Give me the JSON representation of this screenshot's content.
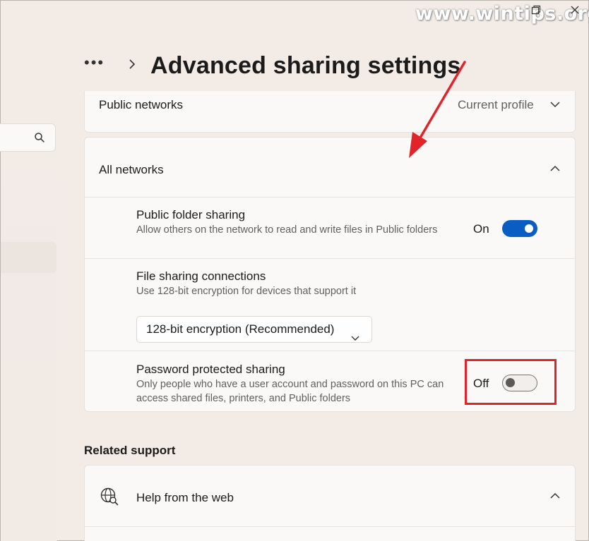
{
  "window": {
    "watermark": "www.wintips.org"
  },
  "header": {
    "more_label": "•••",
    "title": "Advanced sharing settings"
  },
  "public_networks": {
    "label": "Public networks",
    "status": "Current profile"
  },
  "all_networks": {
    "label": "All networks",
    "public_folder_sharing": {
      "title": "Public folder sharing",
      "description": "Allow others on the network to read and write files in Public folders",
      "state_label": "On",
      "state": true
    },
    "file_sharing_connections": {
      "title": "File sharing connections",
      "description": "Use 128-bit encryption for devices that support it",
      "selected_option": "128-bit encryption (Recommended)"
    },
    "password_protected_sharing": {
      "title": "Password protected sharing",
      "description": "Only people who have a user account and password on this PC can access shared files, printers, and Public folders",
      "state_label": "Off",
      "state": false
    }
  },
  "related_support": {
    "heading": "Related support",
    "help_from_web": "Help from the web"
  },
  "colors": {
    "accent": "#0a5dc2",
    "highlight_annotation": "#e0242a",
    "background": "#f3ece6",
    "card": "#fbf9f8"
  },
  "icons": [
    "search-icon",
    "chevron-down-icon",
    "chevron-up-icon",
    "chevron-right-icon",
    "globe-search-icon"
  ]
}
